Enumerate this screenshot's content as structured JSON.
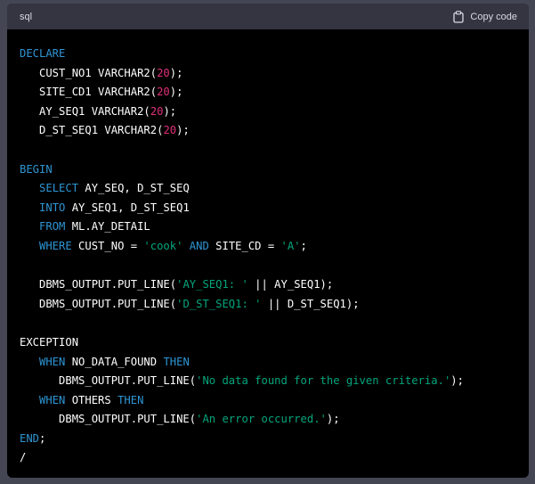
{
  "header": {
    "language": "sql",
    "copy_label": "Copy code",
    "copy_icon": "clipboard-icon"
  },
  "colors": {
    "keyword": "#2e95d3",
    "number": "#df3079",
    "string": "#00a67d",
    "text": "#ffffff",
    "header_bg": "#343541",
    "code_bg": "#000000"
  },
  "code_lines": [
    [
      {
        "t": "kw",
        "v": "DECLARE"
      }
    ],
    [
      {
        "t": "plain",
        "v": "   CUST_NO1 VARCHAR2("
      },
      {
        "t": "num",
        "v": "20"
      },
      {
        "t": "plain",
        "v": ");"
      }
    ],
    [
      {
        "t": "plain",
        "v": "   SITE_CD1 VARCHAR2("
      },
      {
        "t": "num",
        "v": "20"
      },
      {
        "t": "plain",
        "v": ");"
      }
    ],
    [
      {
        "t": "plain",
        "v": "   AY_SEQ1 VARCHAR2("
      },
      {
        "t": "num",
        "v": "20"
      },
      {
        "t": "plain",
        "v": ");"
      }
    ],
    [
      {
        "t": "plain",
        "v": "   D_ST_SEQ1 VARCHAR2("
      },
      {
        "t": "num",
        "v": "20"
      },
      {
        "t": "plain",
        "v": ");"
      }
    ],
    [],
    [
      {
        "t": "kw",
        "v": "BEGIN"
      }
    ],
    [
      {
        "t": "plain",
        "v": "   "
      },
      {
        "t": "kw",
        "v": "SELECT"
      },
      {
        "t": "plain",
        "v": " AY_SEQ, D_ST_SEQ"
      }
    ],
    [
      {
        "t": "plain",
        "v": "   "
      },
      {
        "t": "kw",
        "v": "INTO"
      },
      {
        "t": "plain",
        "v": " AY_SEQ1, D_ST_SEQ1"
      }
    ],
    [
      {
        "t": "plain",
        "v": "   "
      },
      {
        "t": "kw",
        "v": "FROM"
      },
      {
        "t": "plain",
        "v": " ML.AY_DETAIL"
      }
    ],
    [
      {
        "t": "plain",
        "v": "   "
      },
      {
        "t": "kw",
        "v": "WHERE"
      },
      {
        "t": "plain",
        "v": " CUST_NO = "
      },
      {
        "t": "str",
        "v": "'cook'"
      },
      {
        "t": "plain",
        "v": " "
      },
      {
        "t": "kw",
        "v": "AND"
      },
      {
        "t": "plain",
        "v": " SITE_CD = "
      },
      {
        "t": "str",
        "v": "'A'"
      },
      {
        "t": "plain",
        "v": ";"
      }
    ],
    [],
    [
      {
        "t": "plain",
        "v": "   DBMS_OUTPUT.PUT_LINE("
      },
      {
        "t": "str",
        "v": "'AY_SEQ1: '"
      },
      {
        "t": "plain",
        "v": " || AY_SEQ1);"
      }
    ],
    [
      {
        "t": "plain",
        "v": "   DBMS_OUTPUT.PUT_LINE("
      },
      {
        "t": "str",
        "v": "'D_ST_SEQ1: '"
      },
      {
        "t": "plain",
        "v": " || D_ST_SEQ1);"
      }
    ],
    [],
    [
      {
        "t": "plain",
        "v": "EXCEPTION"
      }
    ],
    [
      {
        "t": "plain",
        "v": "   "
      },
      {
        "t": "kw",
        "v": "WHEN"
      },
      {
        "t": "plain",
        "v": " NO_DATA_FOUND "
      },
      {
        "t": "kw",
        "v": "THEN"
      }
    ],
    [
      {
        "t": "plain",
        "v": "      DBMS_OUTPUT.PUT_LINE("
      },
      {
        "t": "str",
        "v": "'No data found for the given criteria.'"
      },
      {
        "t": "plain",
        "v": ");"
      }
    ],
    [
      {
        "t": "plain",
        "v": "   "
      },
      {
        "t": "kw",
        "v": "WHEN"
      },
      {
        "t": "plain",
        "v": " OTHERS "
      },
      {
        "t": "kw",
        "v": "THEN"
      }
    ],
    [
      {
        "t": "plain",
        "v": "      DBMS_OUTPUT.PUT_LINE("
      },
      {
        "t": "str",
        "v": "'An error occurred.'"
      },
      {
        "t": "plain",
        "v": ");"
      }
    ],
    [
      {
        "t": "kw",
        "v": "END"
      },
      {
        "t": "plain",
        "v": ";"
      }
    ],
    [
      {
        "t": "plain",
        "v": "/"
      }
    ]
  ]
}
